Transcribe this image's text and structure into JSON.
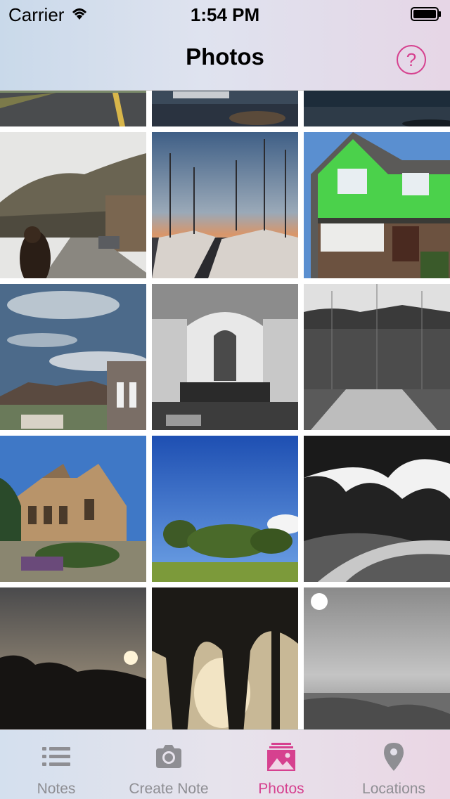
{
  "status_bar": {
    "carrier": "Carrier",
    "time": "1:54 PM"
  },
  "nav": {
    "title": "Photos",
    "help_label": "?"
  },
  "grid": {
    "photos": [
      "road-photo",
      "harbor-photo",
      "water-photo",
      "hillside-street-photo",
      "marina-sunset-photo",
      "green-house-photo",
      "bay-view-photo",
      "castro-theatre-photo",
      "ballfield-photo",
      "stone-building-photo",
      "park-trees-photo",
      "forest-path-photo",
      "sunset-trees-photo",
      "silhouette-trees-photo",
      "ocean-sun-photo"
    ]
  },
  "tabs": [
    {
      "label": "Notes",
      "icon": "list-icon"
    },
    {
      "label": "Create Note",
      "icon": "camera-icon"
    },
    {
      "label": "Photos",
      "icon": "photos-icon"
    },
    {
      "label": "Locations",
      "icon": "map-pin-icon"
    }
  ],
  "colors": {
    "accent": "#d6418f",
    "inactive_tab": "#8e8e93"
  }
}
